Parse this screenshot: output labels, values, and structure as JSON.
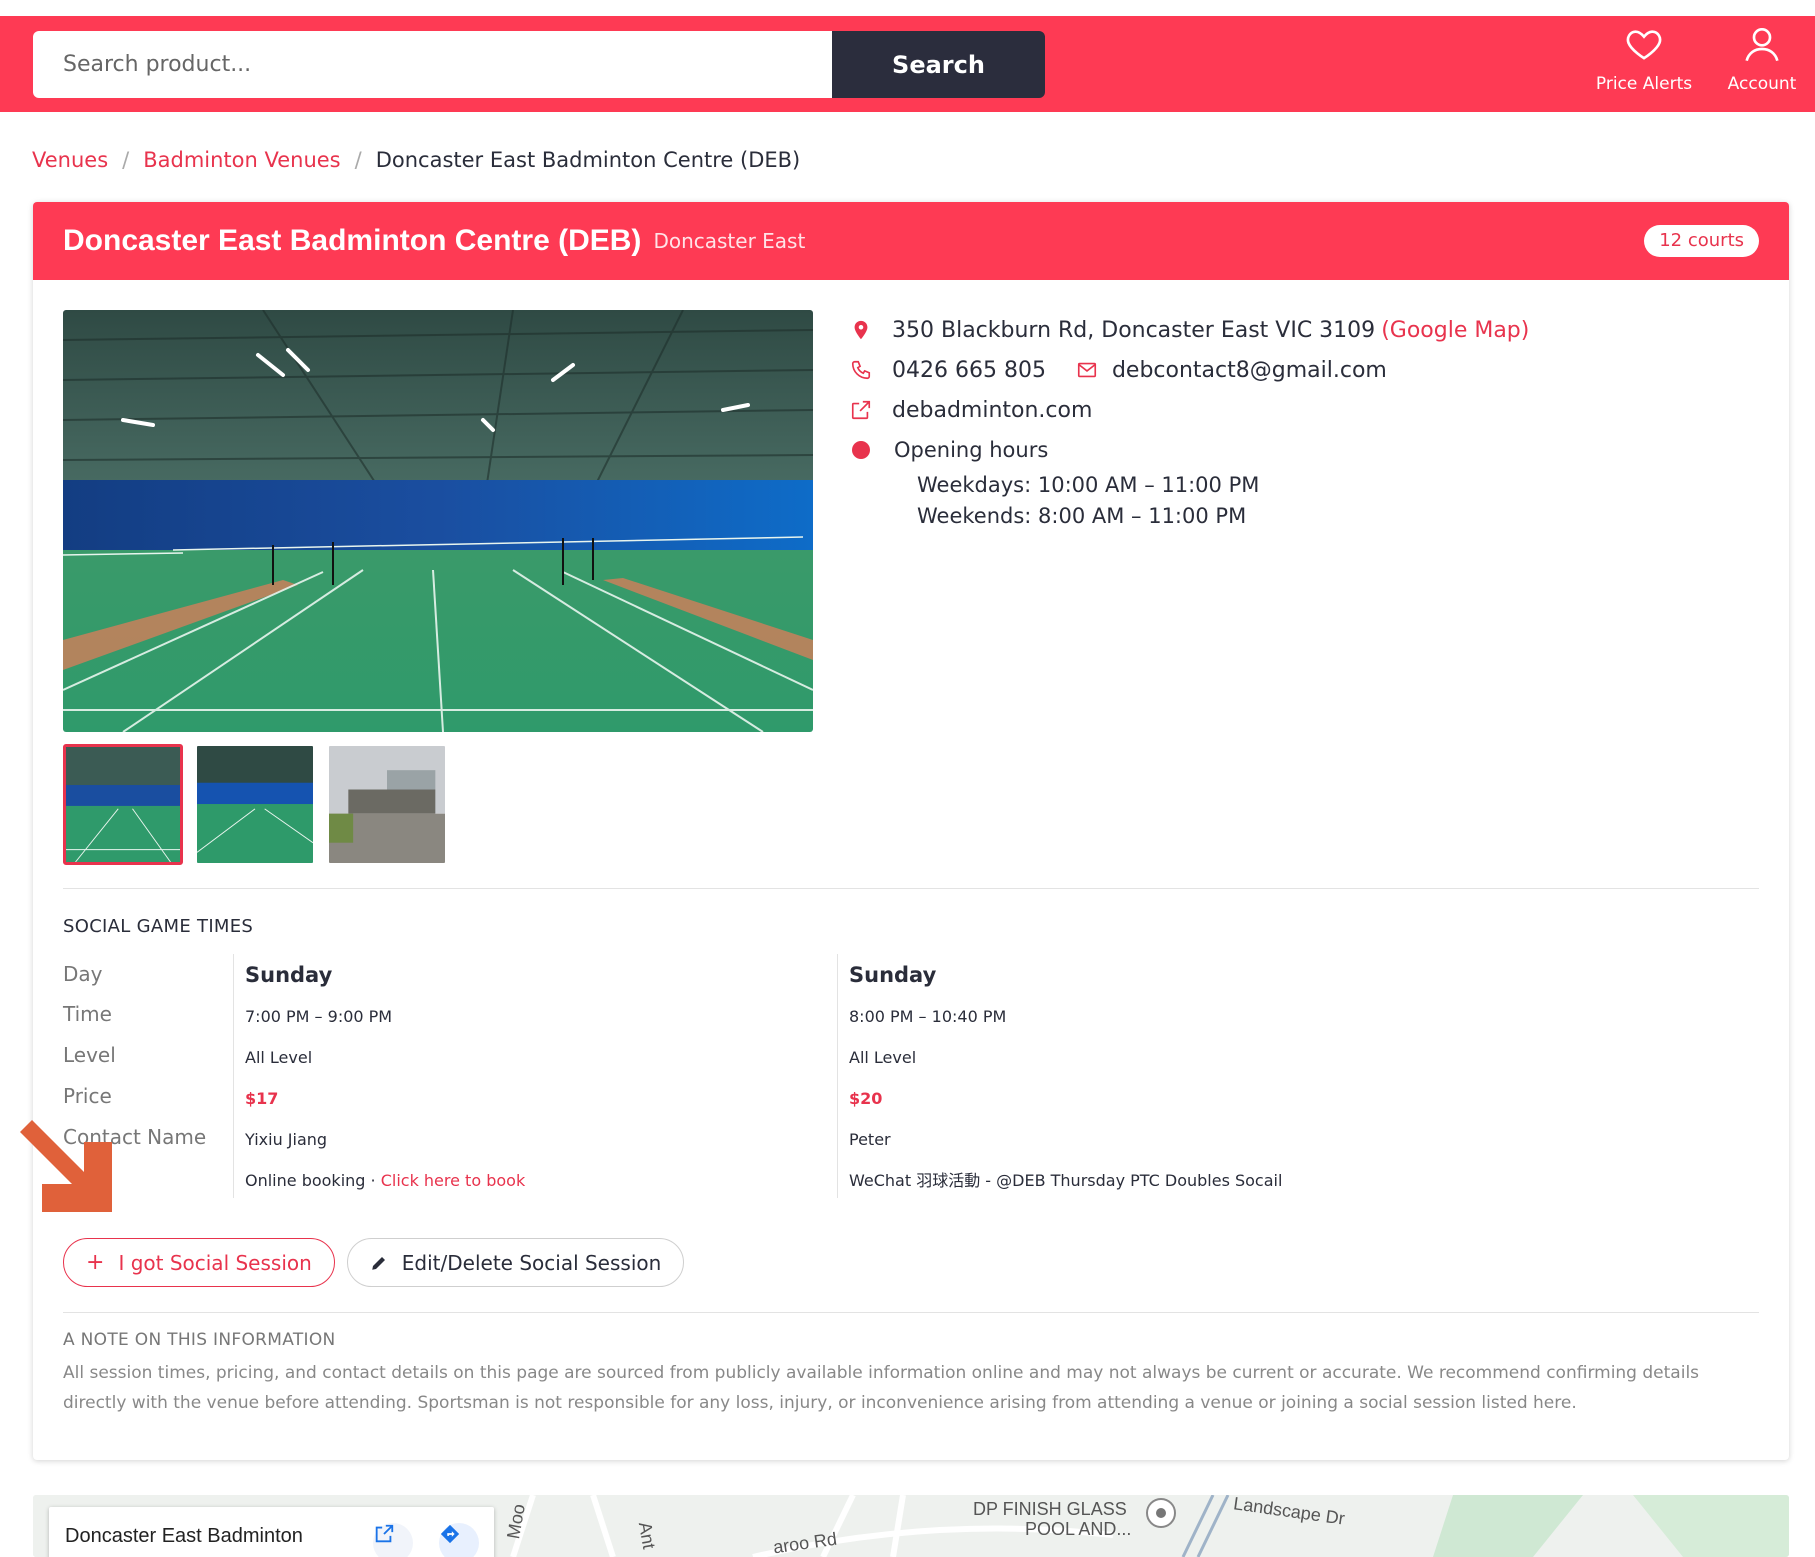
{
  "header": {
    "search_placeholder": "Search product...",
    "search_button": "Search",
    "price_alerts": "Price Alerts",
    "account": "Account"
  },
  "breadcrumb": {
    "items": [
      "Venues",
      "Badminton Venues"
    ],
    "current": "Doncaster East Badminton Centre (DEB)",
    "separator": "/"
  },
  "venue": {
    "title": "Doncaster East Badminton Centre (DEB)",
    "suburb": "Doncaster East",
    "courts": "12 courts",
    "address": "350 Blackburn Rd, Doncaster East VIC 3109",
    "map_link": "(Google Map)",
    "phone": "0426 665 805",
    "email": "debcontact8@gmail.com",
    "website": "debadminton.com",
    "hours_title": "Opening hours",
    "hours": [
      "Weekdays: 10:00 AM – 11:00 PM",
      "Weekends: 8:00 AM – 11:00 PM"
    ]
  },
  "social": {
    "section_title": "SOCIAL GAME TIMES",
    "labels": [
      "Day",
      "Time",
      "Level",
      "Price",
      "Contact Name"
    ],
    "sessions": [
      {
        "day": "Sunday",
        "time": "7:00 PM – 9:00 PM",
        "level": "All Level",
        "price": "$17",
        "contact": "Yixiu Jiang",
        "booking_prefix": "Online booking · ",
        "booking_link": "Click here to book"
      },
      {
        "day": "Sunday",
        "time": "8:00 PM – 10:40 PM",
        "level": "All Level",
        "price": "$20",
        "contact": "Peter",
        "booking_prefix": "WeChat 羽球活動 - @DEB Thursday PTC Doubles Socail",
        "booking_link": ""
      }
    ],
    "add_button": "I got Social Session",
    "edit_button": "Edit/Delete Social Session"
  },
  "note": {
    "title": "A NOTE ON THIS INFORMATION",
    "body": "All session times, pricing, and contact details on this page are sourced from publicly available information online and may not always be current or accurate. We recommend confirming details directly with the venue before attending. Sportsman is not responsible for any loss, injury, or inconvenience arising from attending a venue or joining a social session listed here."
  },
  "map": {
    "card_title": "Doncaster East Badminton",
    "labels": [
      "DP FINISH GLASS",
      "POOL AND...",
      "Landscape Dr",
      "Moo",
      "aroo Rd",
      "Ant"
    ]
  },
  "colors": {
    "brand": "#fe3a54",
    "brand_text": "#e8334d",
    "dark": "#2b2d3d",
    "annotation_arrow": "#e0613a"
  },
  "icons": [
    "heart-icon",
    "user-icon",
    "map-pin-icon",
    "phone-icon",
    "mail-icon",
    "external-link-icon",
    "plus-icon",
    "pencil-icon",
    "arrow-annotation-icon"
  ]
}
